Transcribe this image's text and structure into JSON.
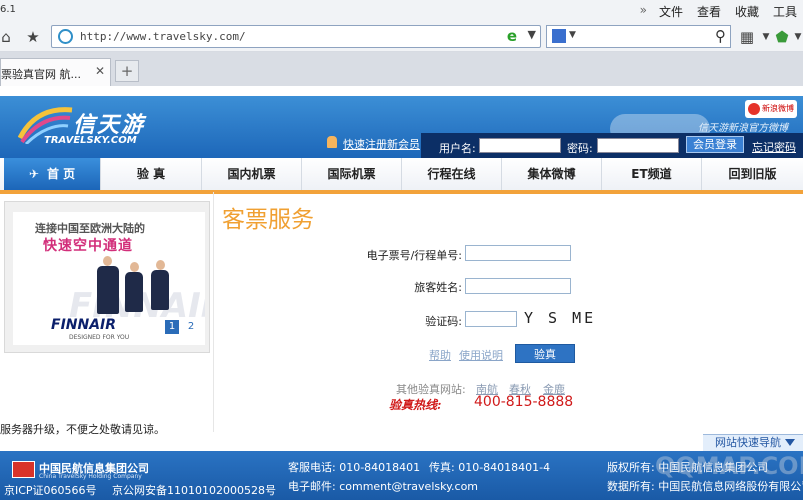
{
  "browser": {
    "version_fragment": "6.1",
    "menu": [
      "文件",
      "查看",
      "收藏",
      "工具"
    ],
    "url": "http://www.travelsky.com/",
    "tab_title": "票验真官网 航...",
    "new_tab_symbol": "+"
  },
  "header": {
    "logo_cn": "信天游",
    "logo_en": "TRAVELSKY.COM",
    "weibo_badge": "新浪微博",
    "weibo_text": "信天游新浪官方微博",
    "register_link": "快速注册新会员",
    "username_label": "用户名:",
    "password_label": "密码:",
    "login_button": "会员登录",
    "forgot_link": "忘记密码"
  },
  "nav": {
    "items": [
      "首 页",
      "验 真",
      "国内机票",
      "国际机票",
      "行程在线",
      "集体微博",
      "ET频道",
      "回到旧版"
    ]
  },
  "banner": {
    "line1": "连接中国至欧洲大陆的",
    "line2": "快速空中通道",
    "brand": "FINNAIR",
    "brand_sub": "DESIGNED FOR YOU",
    "bg_text": "FINNAIR",
    "pages": [
      "1",
      "2"
    ]
  },
  "form": {
    "title": "客票服务",
    "ticket_label": "电子票号/行程单号:",
    "name_label": "旅客姓名:",
    "captcha_label": "验证码:",
    "captcha_text": "Y S ME",
    "help_link": "帮助",
    "usage_link": "使用说明",
    "verify_button": "验真",
    "other_label": "其他验真网站:",
    "other_sites": [
      "南航",
      "春秋",
      "金鹿"
    ],
    "hotline_label": "验真热线:",
    "hotline_number": "400-815-8888"
  },
  "notice": "服务器升级，不便之处敬请见谅。",
  "quick_nav": "网站快速导航",
  "footer": {
    "company_cn": "中国民航信息集团公司",
    "company_en": "China TravelSky Holding Company",
    "icp": "京ICP证060566号",
    "police": "京公网安备11010102000528号",
    "phone": "客服电话: 010-84018401",
    "fax": "传真: 010-84018401-4",
    "email": "电子邮件: comment@travelsky.com",
    "copyright": "版权所有: 中国民航信息集团公司",
    "data_owner": "数据所有: 中国民航信息网络股份有限公司",
    "watermark": "QQMAP.COM"
  }
}
